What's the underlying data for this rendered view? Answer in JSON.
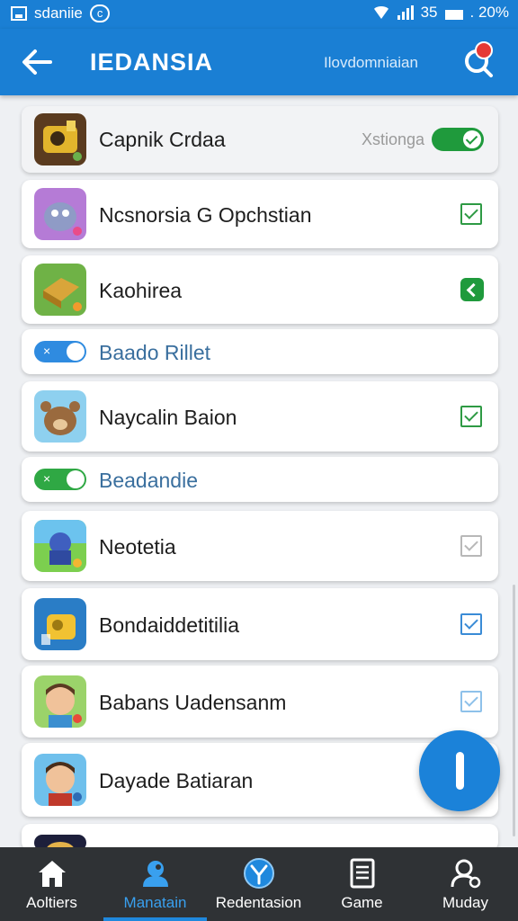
{
  "status_bar": {
    "left_label": "sdaniie",
    "pill_label": "c",
    "signal_text": "35",
    "time": ". 20%"
  },
  "app_bar": {
    "title": "IEDANSIA",
    "subtitle": "Ilovdomniaian"
  },
  "list": {
    "items": [
      {
        "type": "app",
        "name": "Capnik Crdaa",
        "status": "Xstionga",
        "control": "toggle-on"
      },
      {
        "type": "app",
        "name": "Ncsnorsia G Opchstian",
        "control": "checkbox-green"
      },
      {
        "type": "app",
        "name": "Kaohirea",
        "control": "arrow-green"
      },
      {
        "type": "header",
        "name": "Baado Rillet",
        "pill_color": "#2f8be0"
      },
      {
        "type": "app",
        "name": "Naycalin Baion",
        "control": "checkbox-green"
      },
      {
        "type": "header",
        "name": "Beadandie",
        "pill_color": "#2fa844"
      },
      {
        "type": "app",
        "name": "Neotetia",
        "control": "checkbox-gray"
      },
      {
        "type": "app",
        "name": "Bondaiddetitilia",
        "control": "checkbox-blue"
      },
      {
        "type": "app",
        "name": "Babans Uadensanm",
        "control": "checkbox-lightblue"
      },
      {
        "type": "app",
        "name": "Dayade Batiaran",
        "control": "none"
      }
    ]
  },
  "fab": {
    "icon": "exclamation-icon"
  },
  "bottom_nav": {
    "items": [
      {
        "label": "Aoltiers",
        "icon": "home-icon"
      },
      {
        "label": "Manatain",
        "icon": "person-icon",
        "active": true
      },
      {
        "label": "Redentasion",
        "icon": "compass-icon"
      },
      {
        "label": "Game",
        "icon": "document-icon"
      },
      {
        "label": "Muday",
        "icon": "user-settings-icon"
      }
    ]
  },
  "colors": {
    "primary": "#1a7fd4",
    "accent_green": "#1f9a3c",
    "nav_bg": "#2f3235",
    "active_nav": "#39a0ef"
  }
}
